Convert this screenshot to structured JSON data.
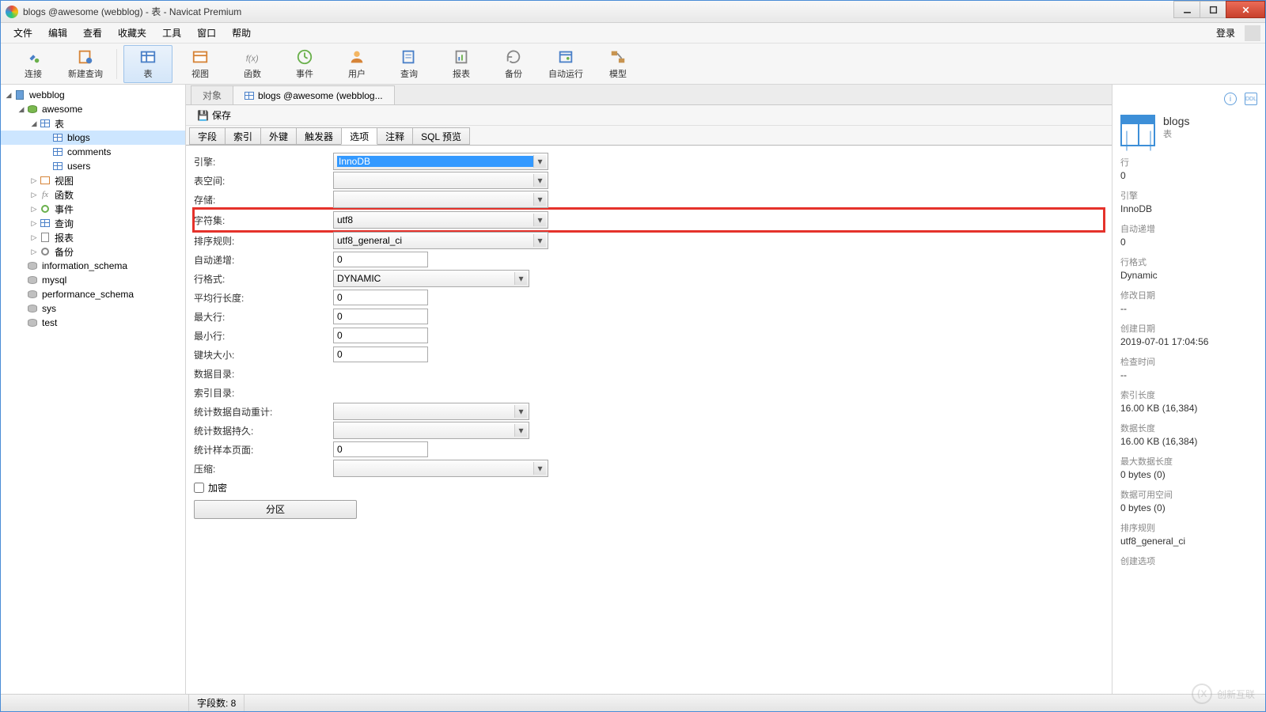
{
  "window": {
    "title": "blogs @awesome (webblog) - 表 - Navicat Premium"
  },
  "menu": {
    "items": [
      "文件",
      "编辑",
      "查看",
      "收藏夹",
      "工具",
      "窗口",
      "帮助"
    ],
    "login": "登录"
  },
  "toolbar": {
    "items": [
      {
        "label": "连接",
        "icon": "plug-icon"
      },
      {
        "label": "新建查询",
        "icon": "new-query-icon"
      },
      {
        "label": "表",
        "icon": "table-icon",
        "active": true,
        "sep_before": true
      },
      {
        "label": "视图",
        "icon": "view-icon"
      },
      {
        "label": "函数",
        "icon": "function-icon"
      },
      {
        "label": "事件",
        "icon": "event-icon"
      },
      {
        "label": "用户",
        "icon": "user-icon"
      },
      {
        "label": "查询",
        "icon": "query-icon"
      },
      {
        "label": "报表",
        "icon": "report-icon"
      },
      {
        "label": "备份",
        "icon": "backup-icon"
      },
      {
        "label": "自动运行",
        "icon": "schedule-icon"
      },
      {
        "label": "模型",
        "icon": "model-icon"
      }
    ]
  },
  "tree": {
    "root": "webblog",
    "db": "awesome",
    "tables_label": "表",
    "tables": [
      "blogs",
      "comments",
      "users"
    ],
    "other_nodes": [
      "视图",
      "函数",
      "事件",
      "查询",
      "报表",
      "备份"
    ],
    "other_dbs": [
      "information_schema",
      "mysql",
      "performance_schema",
      "sys",
      "test"
    ]
  },
  "center": {
    "tabs": {
      "objects": "对象",
      "editor": "blogs @awesome (webblog..."
    },
    "save": "保存",
    "subtabs": [
      "字段",
      "索引",
      "外键",
      "触发器",
      "选项",
      "注释",
      "SQL 预览"
    ],
    "active_subtab": 4,
    "form": {
      "engine": {
        "label": "引擎:",
        "value": "InnoDB"
      },
      "tablespace": {
        "label": "表空间:",
        "value": ""
      },
      "storage": {
        "label": "存储:",
        "value": ""
      },
      "charset": {
        "label": "字符集:",
        "value": "utf8"
      },
      "collation": {
        "label": "排序规则:",
        "value": "utf8_general_ci"
      },
      "auto_increment": {
        "label": "自动递增:",
        "value": "0"
      },
      "row_format": {
        "label": "行格式:",
        "value": "DYNAMIC"
      },
      "avg_row_length": {
        "label": "平均行长度:",
        "value": "0"
      },
      "max_rows": {
        "label": "最大行:",
        "value": "0"
      },
      "min_rows": {
        "label": "最小行:",
        "value": "0"
      },
      "key_block_size": {
        "label": "键块大小:",
        "value": "0"
      },
      "data_directory": {
        "label": "数据目录:",
        "value": ""
      },
      "index_directory": {
        "label": "索引目录:",
        "value": ""
      },
      "stats_auto_recalc": {
        "label": "统计数据自动重计:",
        "value": ""
      },
      "stats_persistent": {
        "label": "统计数据持久:",
        "value": ""
      },
      "stats_sample_pages": {
        "label": "统计样本页面:",
        "value": "0"
      },
      "compression": {
        "label": "压缩:",
        "value": ""
      },
      "encryption": {
        "label": "加密"
      },
      "partition": {
        "label": "分区"
      }
    }
  },
  "info": {
    "name": "blogs",
    "type": "表",
    "items": [
      {
        "k": "行",
        "v": "0"
      },
      {
        "k": "引擎",
        "v": "InnoDB"
      },
      {
        "k": "自动递增",
        "v": "0"
      },
      {
        "k": "行格式",
        "v": "Dynamic"
      },
      {
        "k": "修改日期",
        "v": "--"
      },
      {
        "k": "创建日期",
        "v": "2019-07-01 17:04:56"
      },
      {
        "k": "检查时间",
        "v": "--"
      },
      {
        "k": "索引长度",
        "v": "16.00 KB (16,384)"
      },
      {
        "k": "数据长度",
        "v": "16.00 KB (16,384)"
      },
      {
        "k": "最大数据长度",
        "v": "0 bytes (0)"
      },
      {
        "k": "数据可用空间",
        "v": "0 bytes (0)"
      },
      {
        "k": "排序规则",
        "v": "utf8_general_ci"
      },
      {
        "k": "创建选项",
        "v": ""
      }
    ]
  },
  "status": {
    "field_count_label": "字段数: 8"
  },
  "watermark": "创新互联"
}
